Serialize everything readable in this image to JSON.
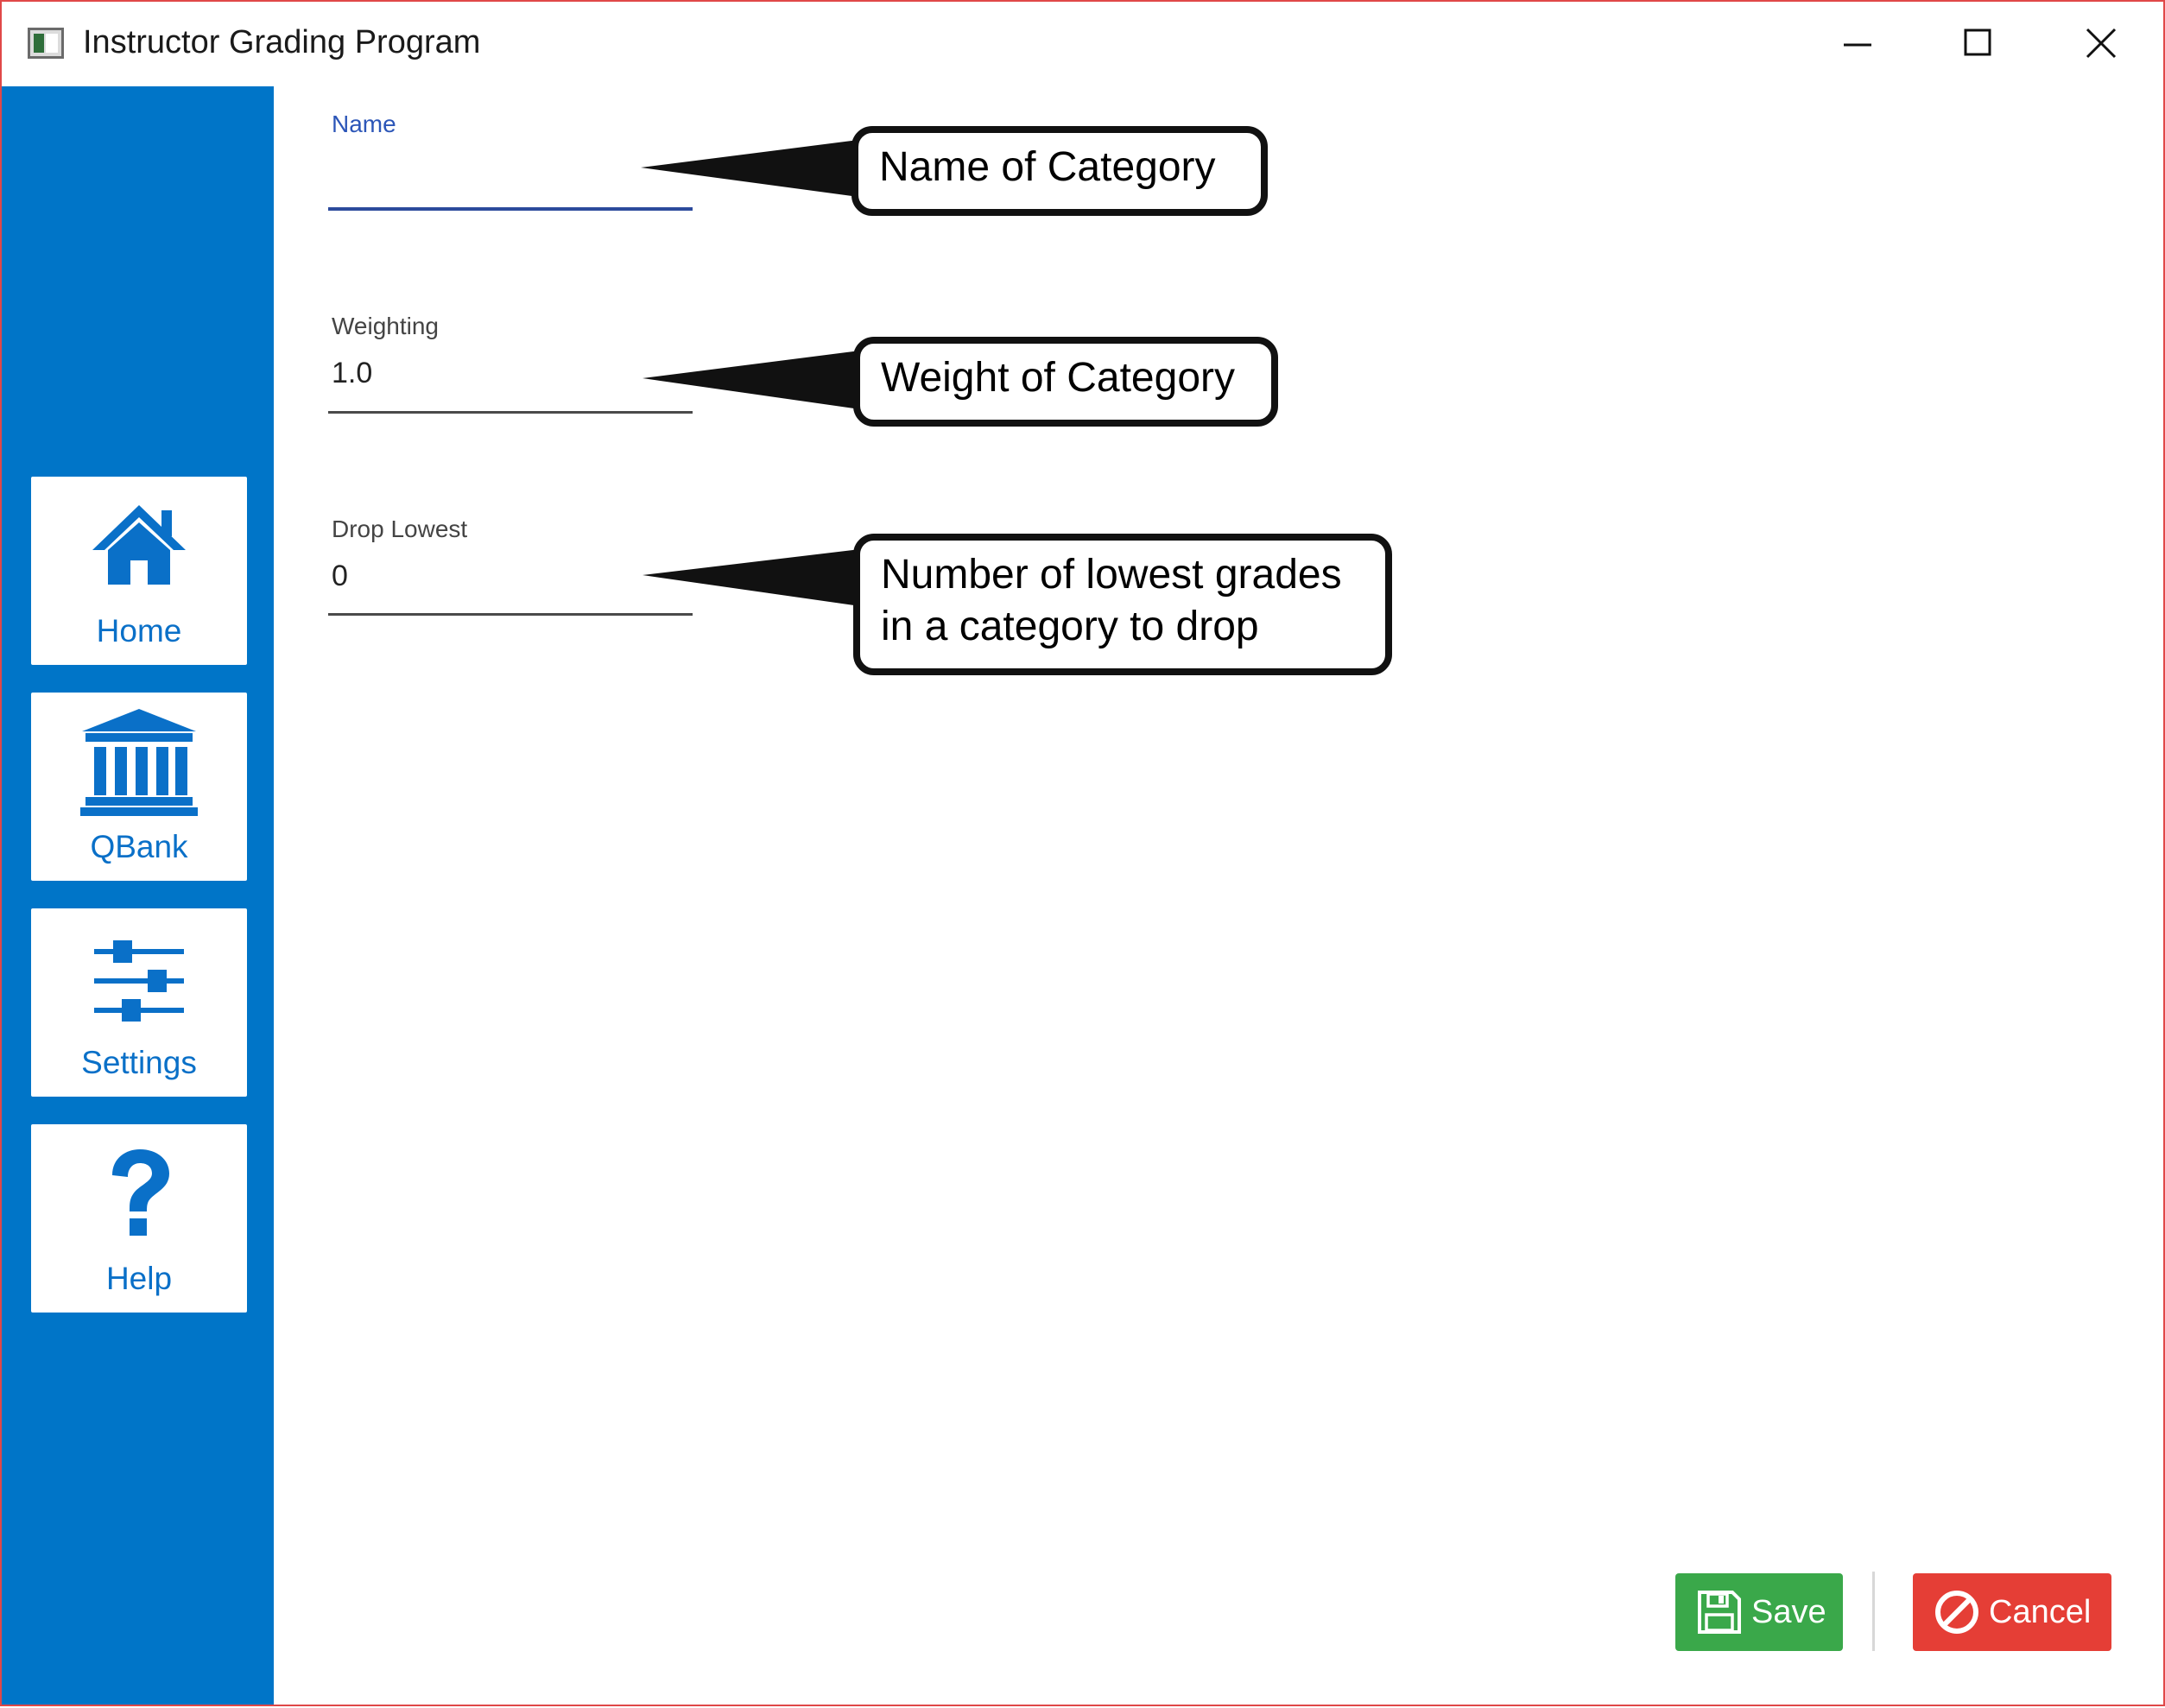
{
  "window": {
    "title": "Instructor Grading Program",
    "controls": {
      "minimize": "minimize-icon",
      "maximize": "maximize-icon",
      "close": "close-icon"
    }
  },
  "sidebar": {
    "background": "#0075c8",
    "items": [
      {
        "label": "Home",
        "icon": "home-icon"
      },
      {
        "label": "QBank",
        "icon": "bank-icon"
      },
      {
        "label": "Settings",
        "icon": "sliders-icon"
      },
      {
        "label": "Help",
        "icon": "question-icon"
      }
    ]
  },
  "form": {
    "name": {
      "label": "Name",
      "value": ""
    },
    "weighting": {
      "label": "Weighting",
      "value": "1.0"
    },
    "drop_lowest": {
      "label": "Drop Lowest",
      "value": "0"
    }
  },
  "callouts": {
    "name": "Name of Category",
    "weight": "Weight of Category",
    "drop_line1": "Number of lowest grades",
    "drop_line2": "in a category to drop"
  },
  "footer": {
    "save_label": "Save",
    "cancel_label": "Cancel",
    "save_color": "#3aa84a",
    "cancel_color": "#e53e36"
  }
}
